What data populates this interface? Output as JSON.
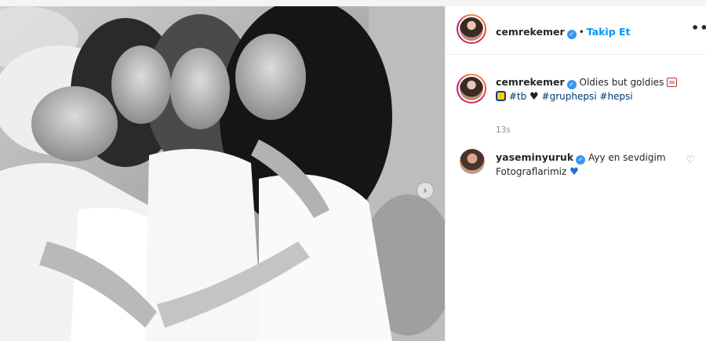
{
  "post": {
    "author": "cemrekemer",
    "follow_separator": "•",
    "follow_label": "Takip Et",
    "more_label": "•••",
    "next_arrow": "›",
    "caption_text": "Oldies but goldies",
    "caption_tags": [
      "#tb",
      "#gruphepsi",
      "#hepsi"
    ],
    "timestamp": "13s"
  },
  "comment": {
    "author": "yaseminyuruk",
    "text": "Ayy en sevdigim Fotograflarimiz",
    "like_icon": "heart-outline-icon"
  },
  "icons": {
    "verified": "verified-badge-icon",
    "more": "more-options-icon",
    "next": "carousel-next-icon"
  },
  "colors": {
    "link": "#0095f6",
    "hashtag": "#00376b",
    "verified": "#3897f0",
    "muted": "#8e8e8e"
  }
}
